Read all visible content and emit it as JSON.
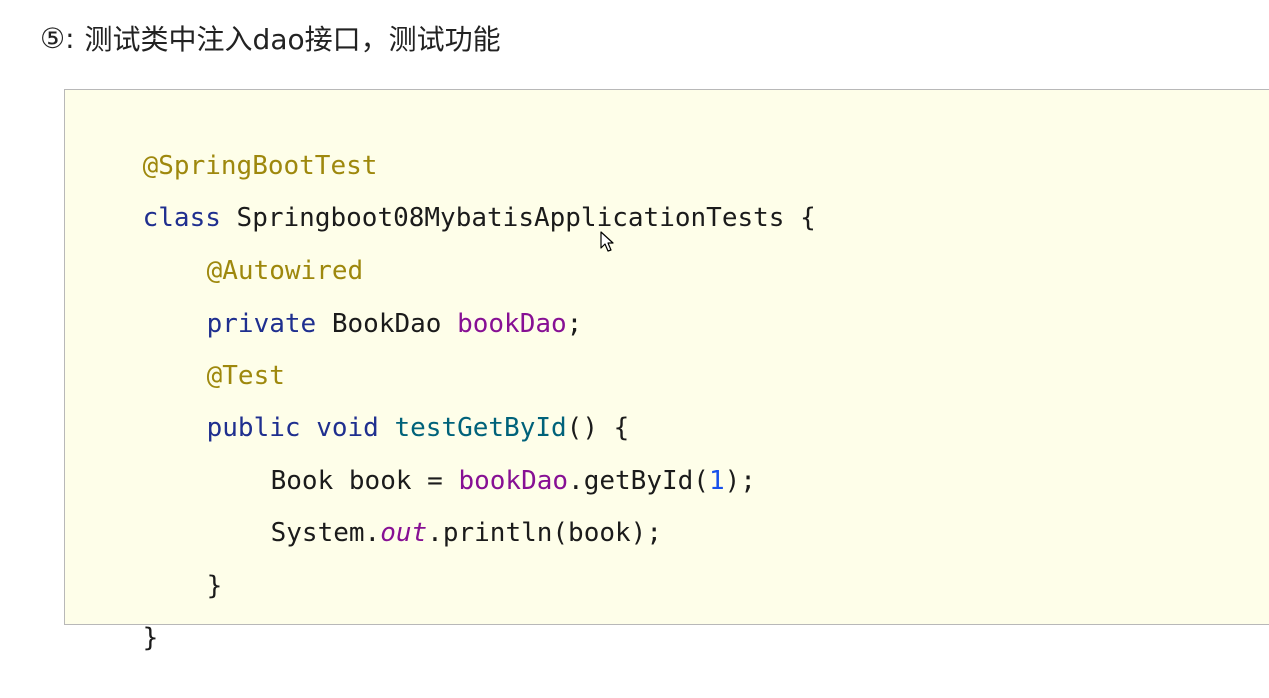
{
  "heading": {
    "marker": "⑤",
    "separator": ":",
    "text": "测试类中注入dao接口，测试功能"
  },
  "code": {
    "line1": {
      "annotation": "@SpringBootTest"
    },
    "line2": {
      "keyword": "class",
      "name": " Springboot08MybatisApplicationTests",
      "rest": " {"
    },
    "line3": {
      "annotation": "@Autowired"
    },
    "line4": {
      "keyword": "private",
      "type": " BookDao ",
      "field": "bookDao",
      "rest": ";"
    },
    "line5": {
      "annotation": "@Test"
    },
    "line6": {
      "keyword1": "public",
      "keyword2": " void",
      "method": " testGetById",
      "rest": "() {"
    },
    "line7": {
      "type": "Book book = ",
      "field": "bookDao",
      "call": ".getById(",
      "number": "1",
      "rest": ");"
    },
    "line8": {
      "type": "System.",
      "static": "out",
      "rest": ".println(book);"
    },
    "line9": {
      "text": "}"
    },
    "line10": {
      "text": "}"
    }
  },
  "icons": {
    "cursor": "mouse-pointer-icon"
  },
  "colors": {
    "background": "#fefee9",
    "annotation": "#9e880d",
    "keyword": "#1f2f8f",
    "field": "#871094",
    "method": "#00627a",
    "number": "#1750eb"
  }
}
